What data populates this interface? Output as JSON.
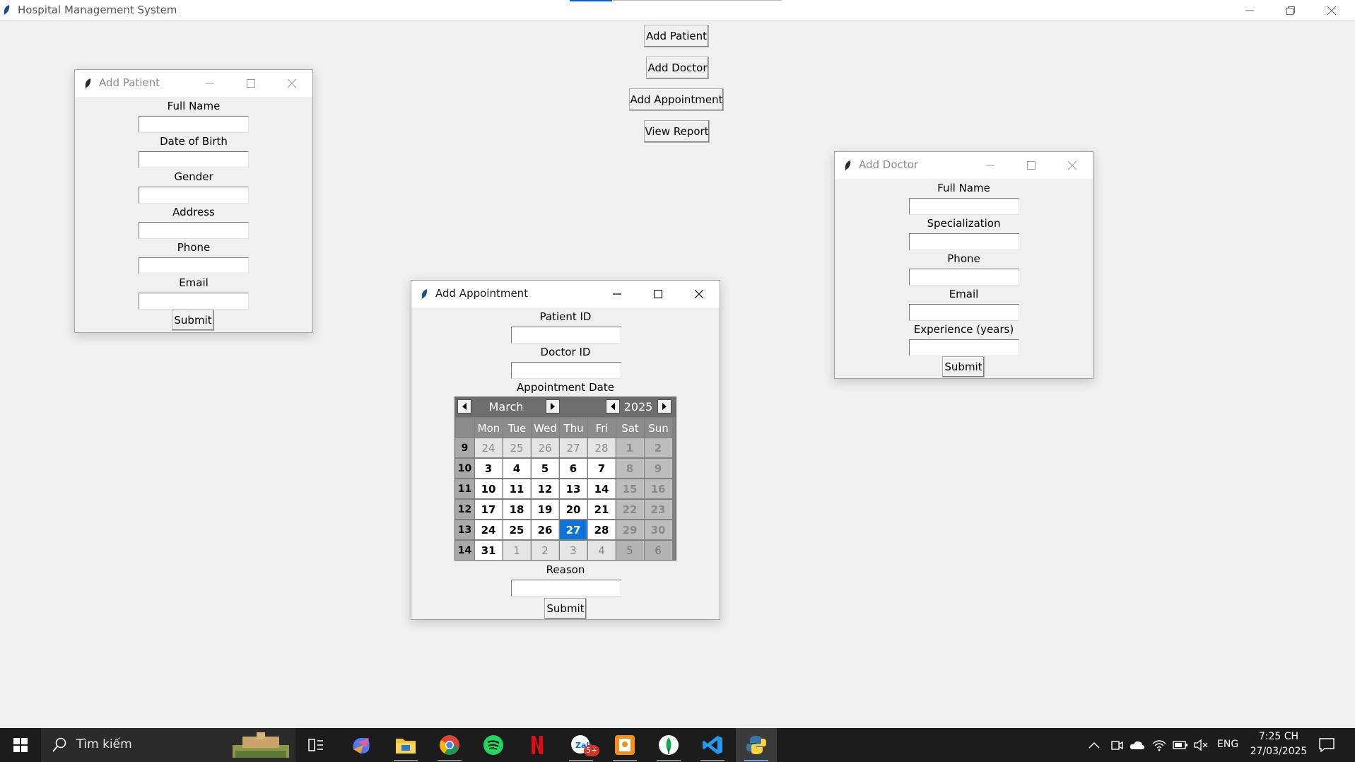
{
  "main_window": {
    "title": "Hospital Management System",
    "buttons": {
      "add_patient": "Add Patient",
      "add_doctor": "Add Doctor",
      "add_appointment": "Add Appointment",
      "view_report": "View Report"
    }
  },
  "patient_window": {
    "title": "Add Patient",
    "labels": [
      "Full Name",
      "Date of Birth",
      "Gender",
      "Address",
      "Phone",
      "Email"
    ],
    "submit": "Submit"
  },
  "doctor_window": {
    "title": "Add Doctor",
    "labels": [
      "Full Name",
      "Specialization",
      "Phone",
      "Email",
      "Experience (years)"
    ],
    "submit": "Submit"
  },
  "appointment_window": {
    "title": "Add Appointment",
    "labels": {
      "patient_id": "Patient ID",
      "doctor_id": "Doctor ID",
      "appointment_date": "Appointment Date",
      "reason": "Reason"
    },
    "submit": "Submit",
    "calendar": {
      "month": "March",
      "year": "2025",
      "day_names": [
        "Mon",
        "Tue",
        "Wed",
        "Thu",
        "Fri",
        "Sat",
        "Sun"
      ],
      "selected": "27",
      "weeks": [
        {
          "week": "9",
          "days": [
            [
              "24",
              1
            ],
            [
              "25",
              1
            ],
            [
              "26",
              1
            ],
            [
              "27",
              1
            ],
            [
              "28",
              1
            ],
            [
              "1",
              0
            ],
            [
              "2",
              0
            ]
          ]
        },
        {
          "week": "10",
          "days": [
            [
              "3",
              0
            ],
            [
              "4",
              0
            ],
            [
              "5",
              0
            ],
            [
              "6",
              0
            ],
            [
              "7",
              0
            ],
            [
              "8",
              0
            ],
            [
              "9",
              0
            ]
          ]
        },
        {
          "week": "11",
          "days": [
            [
              "10",
              0
            ],
            [
              "11",
              0
            ],
            [
              "12",
              0
            ],
            [
              "13",
              0
            ],
            [
              "14",
              0
            ],
            [
              "15",
              0
            ],
            [
              "16",
              0
            ]
          ]
        },
        {
          "week": "12",
          "days": [
            [
              "17",
              0
            ],
            [
              "18",
              0
            ],
            [
              "19",
              0
            ],
            [
              "20",
              0
            ],
            [
              "21",
              0
            ],
            [
              "22",
              0
            ],
            [
              "23",
              0
            ]
          ]
        },
        {
          "week": "13",
          "days": [
            [
              "24",
              0
            ],
            [
              "25",
              0
            ],
            [
              "26",
              0
            ],
            [
              "27",
              0
            ],
            [
              "28",
              0
            ],
            [
              "29",
              0
            ],
            [
              "30",
              0
            ]
          ]
        },
        {
          "week": "14",
          "days": [
            [
              "31",
              0
            ],
            [
              "1",
              1
            ],
            [
              "2",
              1
            ],
            [
              "3",
              1
            ],
            [
              "4",
              1
            ],
            [
              "5",
              1
            ],
            [
              "6",
              1
            ]
          ]
        }
      ]
    }
  },
  "taskbar": {
    "search_placeholder": "Tìm kiếm",
    "notification_badge": "5+",
    "language": "ENG",
    "time": "7:25 CH",
    "date": "27/03/2025"
  },
  "colors": {
    "selected_day": "#0a74da",
    "window_bg": "#f0f0f0",
    "taskbar_bg": "#1c1c1c"
  }
}
